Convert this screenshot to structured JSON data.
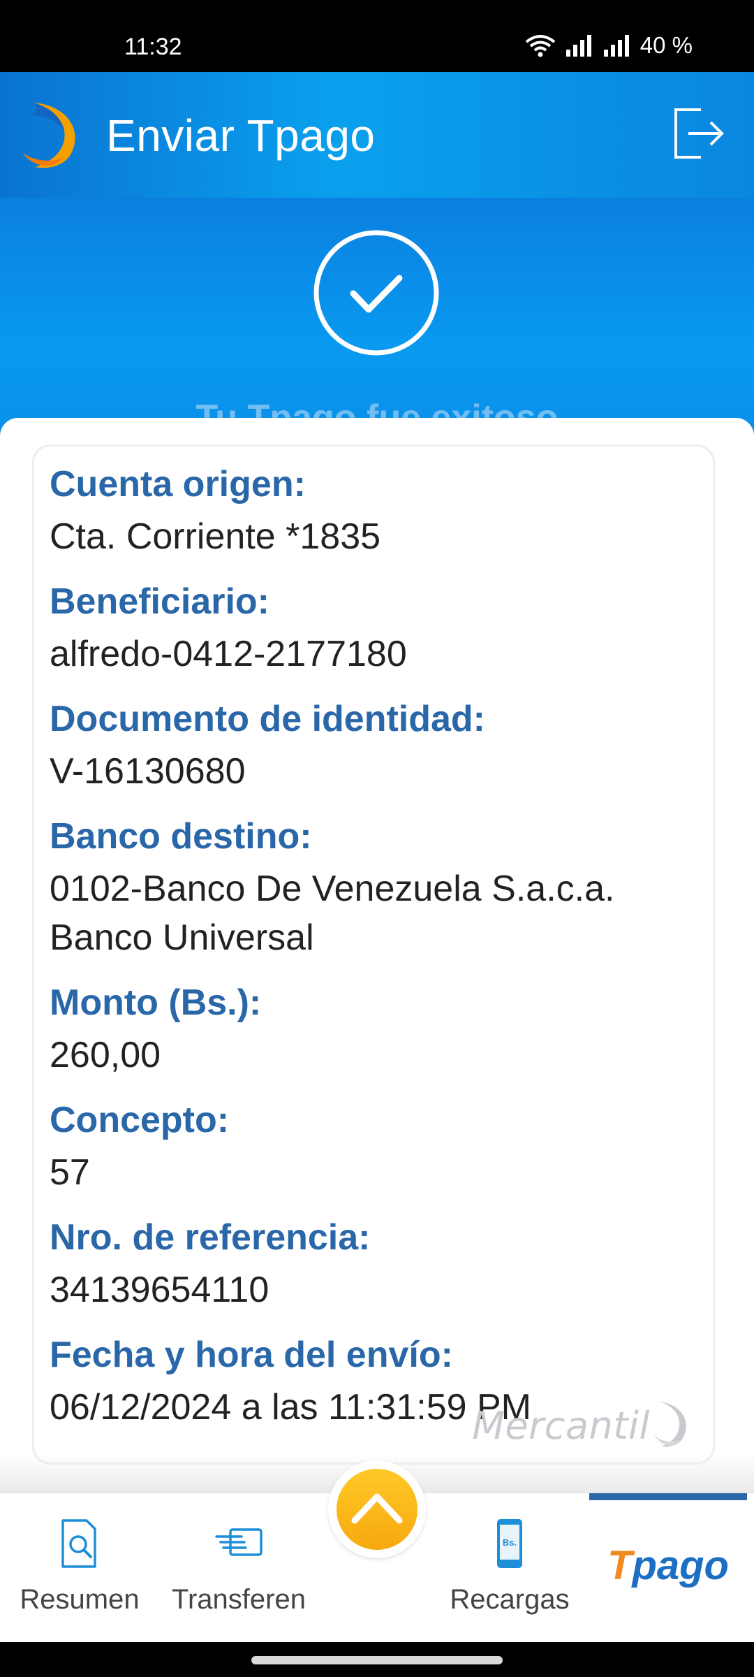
{
  "status_bar": {
    "time": "11:32",
    "battery": "40 %"
  },
  "header": {
    "title": "Enviar Tpago"
  },
  "hero": {
    "status_text": "Tu Tpago fue exitoso"
  },
  "details": [
    {
      "label": "Cuenta origen:",
      "value": "Cta. Corriente *1835"
    },
    {
      "label": "Beneficiario:",
      "value": "alfredo-0412-2177180"
    },
    {
      "label": "Documento de identidad:",
      "value": "V-16130680"
    },
    {
      "label": "Banco destino:",
      "value": "0102-Banco De Venezuela S.a.c.a. Banco Universal"
    },
    {
      "label": "Monto (Bs.):",
      "value": "260,00"
    },
    {
      "label": "Concepto:",
      "value": "57"
    },
    {
      "label": "Nro. de referencia:",
      "value": "34139654110"
    },
    {
      "label": "Fecha y hora del envío:",
      "value": "06/12/2024 a las 11:31:59 PM"
    }
  ],
  "brand_footer": "Mercantil",
  "bottom_nav": {
    "items": [
      {
        "label": "Resumen",
        "icon": "search-document-icon"
      },
      {
        "label": "Transferen",
        "icon": "transfer-icon"
      },
      {
        "label": "Recargas",
        "icon": "phone-bs-icon"
      }
    ],
    "tpago_t": "T",
    "tpago_rest": "pago",
    "fab_icon": "chevron-up-icon",
    "recargas_badge": "Bs."
  },
  "colors": {
    "primary_blue": "#0a8ee8",
    "label_blue": "#2a67a8",
    "fab_yellow": "#f7a90e",
    "tpago_orange": "#f08a1e"
  }
}
